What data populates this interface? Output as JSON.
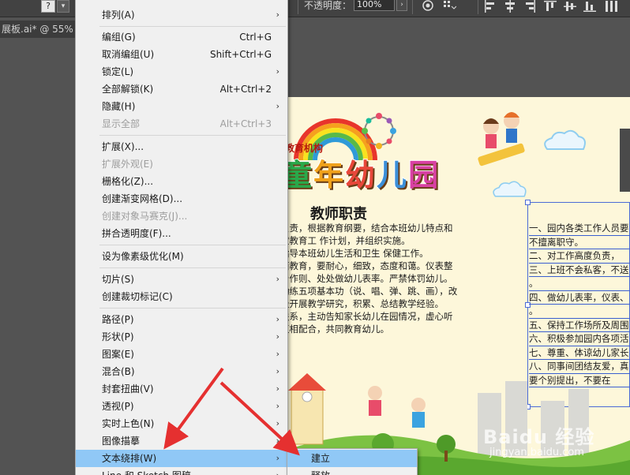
{
  "toolbar": {
    "question_box": "?",
    "opacity_label": "不透明度：",
    "opacity_value": "100%"
  },
  "document_tab": "展板.ai* @ 55%",
  "menu": {
    "items": [
      {
        "label": "排列(A)",
        "shortcut": "",
        "submenu": true,
        "disabled": false
      },
      {
        "label": "编组(G)",
        "shortcut": "Ctrl+G",
        "submenu": false,
        "disabled": false
      },
      {
        "label": "取消编组(U)",
        "shortcut": "Shift+Ctrl+G",
        "submenu": false,
        "disabled": false
      },
      {
        "label": "锁定(L)",
        "shortcut": "",
        "submenu": true,
        "disabled": false
      },
      {
        "label": "全部解锁(K)",
        "shortcut": "Alt+Ctrl+2",
        "submenu": false,
        "disabled": false
      },
      {
        "label": "隐藏(H)",
        "shortcut": "",
        "submenu": true,
        "disabled": false
      },
      {
        "label": "显示全部",
        "shortcut": "Alt+Ctrl+3",
        "submenu": false,
        "disabled": true
      },
      {
        "label": "扩展(X)...",
        "shortcut": "",
        "submenu": false,
        "disabled": false
      },
      {
        "label": "扩展外观(E)",
        "shortcut": "",
        "submenu": false,
        "disabled": true
      },
      {
        "label": "栅格化(Z)...",
        "shortcut": "",
        "submenu": false,
        "disabled": false
      },
      {
        "label": "创建渐变网格(D)...",
        "shortcut": "",
        "submenu": false,
        "disabled": false
      },
      {
        "label": "创建对象马赛克(J)...",
        "shortcut": "",
        "submenu": false,
        "disabled": true
      },
      {
        "label": "拼合透明度(F)...",
        "shortcut": "",
        "submenu": false,
        "disabled": false
      },
      {
        "label": "设为像素级优化(M)",
        "shortcut": "",
        "submenu": false,
        "disabled": false
      },
      {
        "label": "切片(S)",
        "shortcut": "",
        "submenu": true,
        "disabled": false
      },
      {
        "label": "创建裁切标记(C)",
        "shortcut": "",
        "submenu": false,
        "disabled": false
      },
      {
        "label": "路径(P)",
        "shortcut": "",
        "submenu": true,
        "disabled": false
      },
      {
        "label": "形状(P)",
        "shortcut": "",
        "submenu": true,
        "disabled": false
      },
      {
        "label": "图案(E)",
        "shortcut": "",
        "submenu": true,
        "disabled": false
      },
      {
        "label": "混合(B)",
        "shortcut": "",
        "submenu": true,
        "disabled": false
      },
      {
        "label": "封套扭曲(V)",
        "shortcut": "",
        "submenu": true,
        "disabled": false
      },
      {
        "label": "透视(P)",
        "shortcut": "",
        "submenu": true,
        "disabled": false
      },
      {
        "label": "实时上色(N)",
        "shortcut": "",
        "submenu": true,
        "disabled": false
      },
      {
        "label": "图像描摹",
        "shortcut": "",
        "submenu": true,
        "disabled": false
      },
      {
        "label": "文本绕排(W)",
        "shortcut": "",
        "submenu": true,
        "disabled": false,
        "highlighted": true
      },
      {
        "label": "Line 和 Sketch 图稿",
        "shortcut": "",
        "submenu": true,
        "disabled": false
      }
    ],
    "arrow_glyph": "›"
  },
  "submenu": {
    "items": [
      {
        "label": "建立",
        "highlighted": true
      },
      {
        "label": "释放",
        "highlighted": false
      }
    ]
  },
  "artboard": {
    "org_subtitle": "教育机构",
    "kg_title": [
      "童",
      "年",
      "幼",
      "儿",
      "园"
    ],
    "duties_title": "教师职责",
    "duties_lines": [
      "负责，根据教育纲要，结合本班幼儿特点和",
      "定教育工 作计划，并组织实施。",
      "指导本班幼儿生活和卫生 保健工作。",
      "面教育，要耐心，细致，态度和蔼。仪表整",
      "身作则、处处做幼儿表率。严禁体罚幼儿。",
      "勤练五项基本功（说、唱、弹、跳、画），改",
      "极开展教学研究，积累、总结教学经验。",
      "联系，主动告知家长幼儿在园情况，虚心听",
      "互相配合，共同教育幼儿。"
    ],
    "rules_lines": [
      "一、园内各类工作人员要",
      "    不擅离职守。",
      "二、对工作高度负责，",
      "三、上班不会私客，不送",
      "    。",
      "四、做幼儿表率，仪表、",
      "    。",
      "五、保持工作场所及周围",
      "六、积极参加园内各项活",
      "七、尊重、体谅幼儿家长",
      "八、同事间团结友爱，真",
      "    要个别提出，不要在"
    ]
  },
  "watermark": {
    "brand": "Baidu 经验",
    "url": "jingyan.baidu.com"
  },
  "colors": {
    "menu_highlight": "#90c8f6",
    "arrow_red": "#e53030",
    "selection_blue": "#4b6bd6",
    "artboard_bg": "#fdf7da"
  }
}
